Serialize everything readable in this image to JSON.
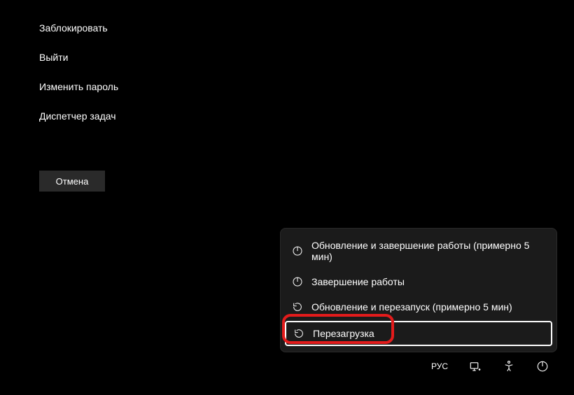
{
  "securityOptions": {
    "lock": "Заблокировать",
    "signOut": "Выйти",
    "changePassword": "Изменить пароль",
    "taskManager": "Диспетчер задач"
  },
  "cancel": "Отмена",
  "powerMenu": {
    "updateShutdown": "Обновление и завершение работы (примерно 5 мин)",
    "shutdown": "Завершение работы",
    "updateRestart": "Обновление и перезапуск (примерно 5 мин)",
    "restart": "Перезагрузка"
  },
  "tray": {
    "language": "РУС"
  }
}
